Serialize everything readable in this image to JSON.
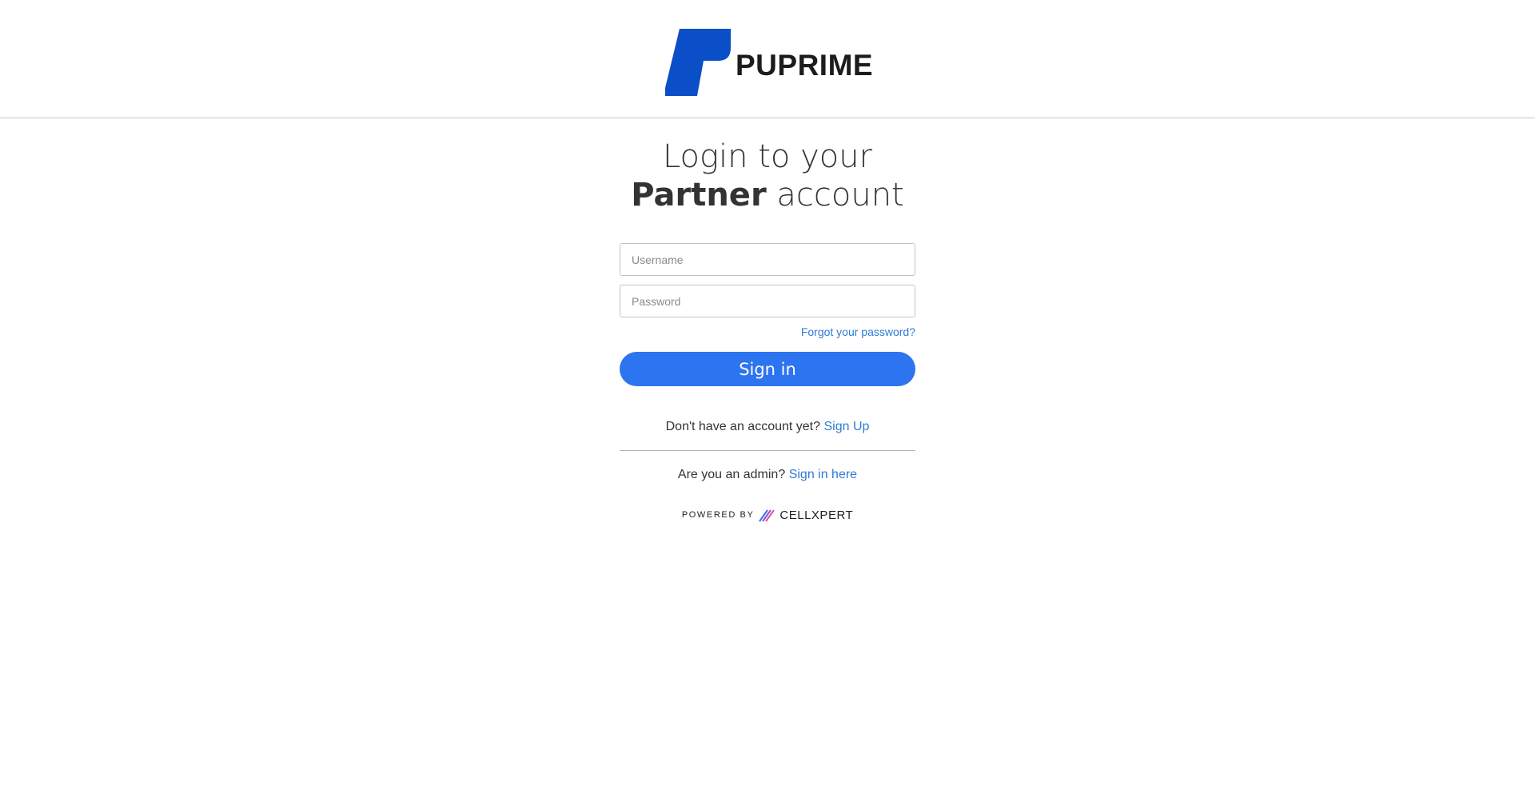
{
  "brand": {
    "name": "PUPRIME",
    "logo_icon": "puprime-logo-icon",
    "logo_color": "#0b4fc8"
  },
  "title": {
    "line1": "Login to your",
    "bold": "Partner",
    "rest": "account"
  },
  "form": {
    "username_placeholder": "Username",
    "password_placeholder": "Password",
    "forgot_label": "Forgot your password?",
    "signin_label": "Sign in"
  },
  "signup": {
    "prompt": "Don't have an account yet?",
    "link": "Sign Up"
  },
  "admin": {
    "prompt": "Are you an admin?",
    "link": "Sign in here"
  },
  "footer": {
    "powered_by": "POWERED BY",
    "vendor": "CELLXPERT",
    "vendor_icon": "cellxpert-logo-icon"
  },
  "colors": {
    "accent": "#2c74f0",
    "link": "#2f7bd6"
  }
}
